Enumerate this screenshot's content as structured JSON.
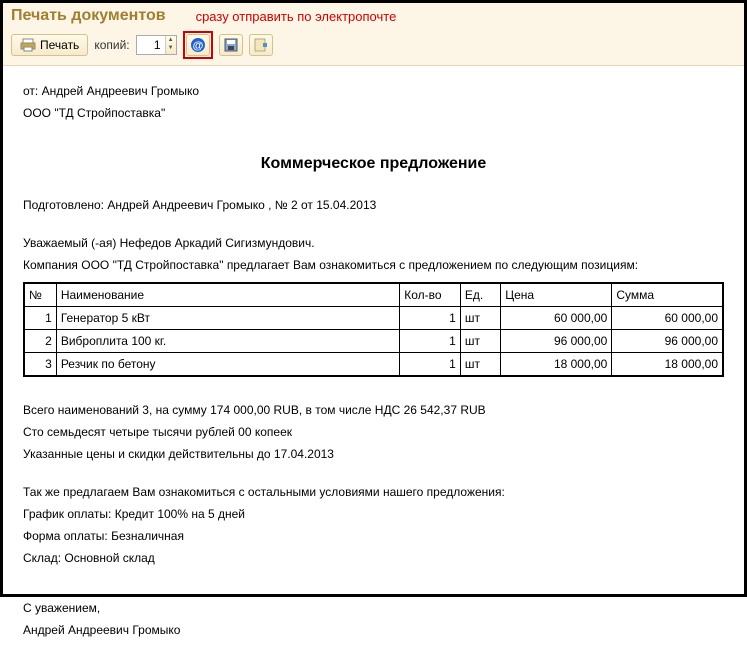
{
  "window": {
    "title": "Печать документов",
    "annotation": "сразу отправить по электропочте"
  },
  "toolbar": {
    "print_label": "Печать",
    "copies_label": "копий:",
    "copies_value": "1"
  },
  "doc": {
    "from_line": "от: Андрей Андреевич Громыко",
    "company_line": "ООО \"ТД Стройпоставка\"",
    "heading": "Коммерческое предложение",
    "prepared": "Подготовлено: Андрей Андреевич Громыко , № 2 от 15.04.2013",
    "greeting": "Уважаемый (-ая) Нефедов Аркадий Сигизмундович.",
    "intro": "Компания ООО \"ТД Стройпоставка\" предлагает Вам ознакомиться с предложением по следующим позициям:",
    "table": {
      "headers": {
        "num": "№",
        "name": "Наименование",
        "qty": "Кол-во",
        "unit": "Ед.",
        "price": "Цена",
        "sum": "Сумма"
      },
      "rows": [
        {
          "num": "1",
          "name": "Генератор 5 кВт",
          "qty": "1",
          "unit": "шт",
          "price": "60 000,00",
          "sum": "60 000,00"
        },
        {
          "num": "2",
          "name": "Виброплита 100 кг.",
          "qty": "1",
          "unit": "шт",
          "price": "96 000,00",
          "sum": "96 000,00"
        },
        {
          "num": "3",
          "name": "Резчик по бетону",
          "qty": "1",
          "unit": "шт",
          "price": "18 000,00",
          "sum": "18 000,00"
        }
      ]
    },
    "total1": "Всего наименований 3, на сумму 174 000,00 RUB, в том числе НДС 26 542,37 RUB",
    "total2": "Сто семьдесят четыре тысячи рублей 00 копеек",
    "validity": "Указанные цены и скидки действительны до 17.04.2013",
    "terms_intro": "Так же предлагаем Вам ознакомиться с остальными условиями нашего предложения:",
    "term1": "График оплаты: Кредит 100% на 5 дней",
    "term2": "Форма оплаты: Безналичная",
    "term3": "Склад: Основной склад",
    "sign1": "С уважением,",
    "sign2": "Андрей Андреевич Громыко"
  }
}
